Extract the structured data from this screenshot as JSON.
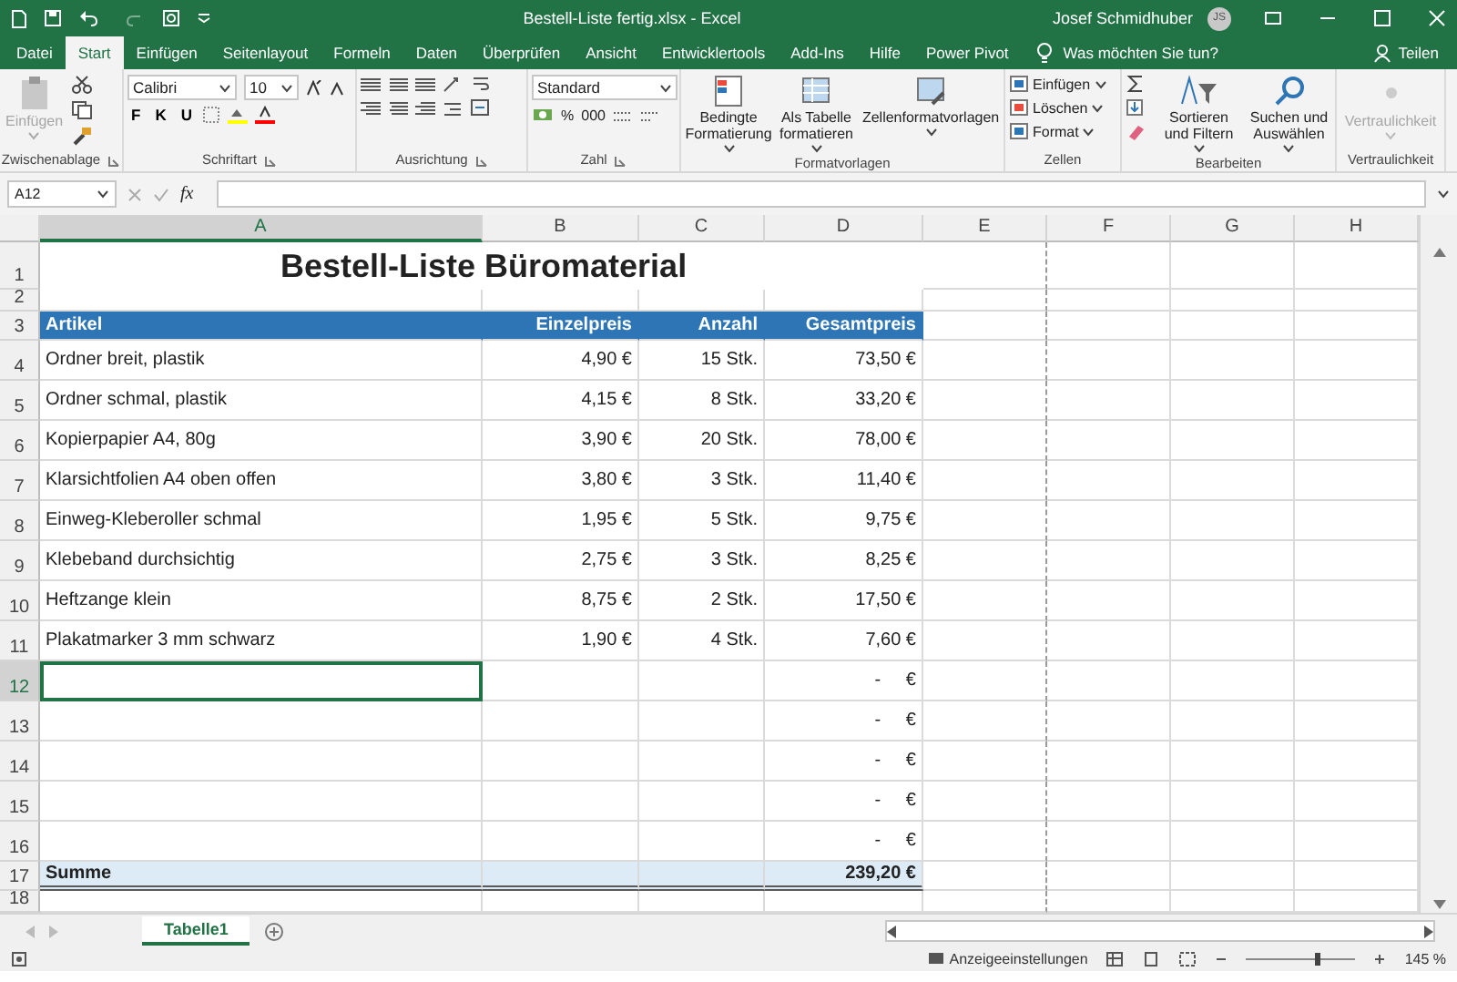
{
  "title_bar": {
    "document": "Bestell-Liste fertig.xlsx  -  Excel",
    "user": "Josef Schmidhuber",
    "avatar": "JS"
  },
  "tabs": [
    {
      "label": "Datei",
      "selected": false
    },
    {
      "label": "Start",
      "selected": true
    },
    {
      "label": "Einfügen",
      "selected": false
    },
    {
      "label": "Seitenlayout",
      "selected": false
    },
    {
      "label": "Formeln",
      "selected": false
    },
    {
      "label": "Daten",
      "selected": false
    },
    {
      "label": "Überprüfen",
      "selected": false
    },
    {
      "label": "Ansicht",
      "selected": false
    },
    {
      "label": "Entwicklertools",
      "selected": false
    },
    {
      "label": "Add-Ins",
      "selected": false
    },
    {
      "label": "Hilfe",
      "selected": false
    },
    {
      "label": "Power Pivot",
      "selected": false
    }
  ],
  "tell_me": {
    "placeholder": "Was möchten Sie tun?"
  },
  "share": "Teilen",
  "ribbon": {
    "groups": [
      {
        "label": "Zwischenablage",
        "kind": "clipboard",
        "buttons": [
          {
            "label": "Einfügen",
            "disabled": true
          }
        ]
      },
      {
        "label": "Schriftart",
        "kind": "font",
        "font": "Calibri",
        "size": "10",
        "styles": [
          "F",
          "K",
          "U"
        ]
      },
      {
        "label": "Ausrichtung",
        "kind": "alignment"
      },
      {
        "label": "Zahl",
        "kind": "number",
        "format": "Standard",
        "symbols": [
          "%",
          "000"
        ]
      },
      {
        "label": "Formatvorlagen",
        "kind": "styles",
        "buttons": [
          {
            "label": "Bedingte Formatierung",
            "disabled": false
          },
          {
            "label": "Als Tabelle formatieren",
            "disabled": false
          },
          {
            "label": "Zellenformatvorlagen",
            "disabled": false
          }
        ]
      },
      {
        "label": "Zellen",
        "kind": "cells",
        "buttons": [
          {
            "label": "Einfügen",
            "disabled": false
          },
          {
            "label": "Löschen",
            "disabled": false
          },
          {
            "label": "Format",
            "disabled": false
          }
        ]
      },
      {
        "label": "Bearbeiten",
        "kind": "editing",
        "buttons": [
          {
            "label": "Sortieren und Filtern",
            "disabled": false
          },
          {
            "label": "Suchen und Auswählen",
            "disabled": false
          }
        ]
      },
      {
        "label": "Vertraulichkeit",
        "kind": "sensitivity",
        "buttons": [
          {
            "label": "Vertraulichkeit",
            "disabled": true
          }
        ]
      }
    ]
  },
  "formula_bar": {
    "name_box": "A12",
    "function_label": "fx"
  },
  "sheet": {
    "columns": [
      {
        "letter": "A",
        "selected": true
      },
      {
        "letter": "B",
        "selected": false
      },
      {
        "letter": "C",
        "selected": false
      },
      {
        "letter": "D",
        "selected": false
      },
      {
        "letter": "E",
        "selected": false
      },
      {
        "letter": "F",
        "selected": false
      },
      {
        "letter": "G",
        "selected": false
      },
      {
        "letter": "H",
        "selected": false
      }
    ],
    "rows": [
      {
        "number": "1",
        "kind": "title",
        "selected": false,
        "cells": [
          "",
          "Bestell-Liste Büromaterial",
          "",
          ""
        ]
      },
      {
        "number": "2",
        "kind": "blank",
        "selected": false,
        "cells": []
      },
      {
        "number": "3",
        "kind": "header",
        "selected": false,
        "cells": [
          "Artikel",
          "Einzelpreis",
          "Anzahl",
          "Gesamtpreis"
        ]
      },
      {
        "number": "4",
        "kind": "item",
        "selected": false,
        "cells": [
          "Ordner breit, plastik",
          "4,90 €",
          "15 Stk.",
          "73,50 €"
        ]
      },
      {
        "number": "5",
        "kind": "item",
        "selected": false,
        "cells": [
          "Ordner schmal, plastik",
          "4,15 €",
          "8 Stk.",
          "33,20 €"
        ]
      },
      {
        "number": "6",
        "kind": "item",
        "selected": false,
        "cells": [
          "Kopierpapier A4, 80g",
          "3,90 €",
          "20 Stk.",
          "78,00 €"
        ]
      },
      {
        "number": "7",
        "kind": "item",
        "selected": false,
        "cells": [
          "Klarsichtfolien A4 oben offen",
          "3,80 €",
          "3 Stk.",
          "11,40 €"
        ]
      },
      {
        "number": "8",
        "kind": "item",
        "selected": false,
        "cells": [
          "Einweg-Kleberoller schmal",
          "1,95 €",
          "5 Stk.",
          "9,75 €"
        ]
      },
      {
        "number": "9",
        "kind": "item",
        "selected": false,
        "cells": [
          "Klebeband durchsichtig",
          "2,75 €",
          "3 Stk.",
          "8,25 €"
        ]
      },
      {
        "number": "10",
        "kind": "item",
        "selected": false,
        "cells": [
          "Heftzange klein",
          "8,75 €",
          "2 Stk.",
          "17,50 €"
        ]
      },
      {
        "number": "11",
        "kind": "item",
        "selected": false,
        "cells": [
          "Plakatmarker 3 mm schwarz",
          "1,90 €",
          "4 Stk.",
          "7,60 €"
        ]
      },
      {
        "number": "12",
        "kind": "item",
        "selected": true,
        "cells": [
          "",
          "",
          "",
          "-     €"
        ]
      },
      {
        "number": "13",
        "kind": "item",
        "selected": false,
        "cells": [
          "",
          "",
          "",
          "-     €"
        ]
      },
      {
        "number": "14",
        "kind": "item",
        "selected": false,
        "cells": [
          "",
          "",
          "",
          "-     €"
        ]
      },
      {
        "number": "15",
        "kind": "item",
        "selected": false,
        "cells": [
          "",
          "",
          "",
          "-     €"
        ]
      },
      {
        "number": "16",
        "kind": "item",
        "selected": false,
        "cells": [
          "",
          "",
          "",
          "-     €"
        ]
      },
      {
        "number": "17",
        "kind": "total",
        "selected": false,
        "cells": [
          "Summe",
          "",
          "",
          "239,20 €"
        ]
      },
      {
        "number": "18",
        "kind": "blank",
        "selected": false,
        "cells": []
      }
    ]
  },
  "sheet_tabs": [
    {
      "label": "Tabelle1",
      "selected": true
    }
  ],
  "status_bar": {
    "display_settings": "Anzeigeeinstellungen",
    "zoom": "145 %",
    "level": 0.62
  }
}
